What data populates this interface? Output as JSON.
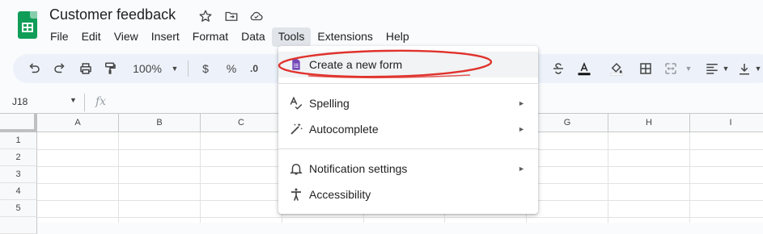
{
  "doc": {
    "title": "Customer feedback"
  },
  "menubar": [
    "File",
    "Edit",
    "View",
    "Insert",
    "Format",
    "Data",
    "Tools",
    "Extensions",
    "Help"
  ],
  "toolbar": {
    "zoom": "100%",
    "currency": "$",
    "percent": "%",
    "decimal": ".0"
  },
  "formula_bar": {
    "cell_ref": "J18",
    "fx": "fx"
  },
  "grid": {
    "columns": [
      "A",
      "B",
      "C",
      "G",
      "H",
      "I"
    ],
    "rows": [
      "1",
      "2",
      "3",
      "4",
      "5"
    ]
  },
  "tools_menu": {
    "items": [
      {
        "label": "Create a new form",
        "icon": "forms-icon",
        "submenu": false
      },
      {
        "label": "Spelling",
        "icon": "spellcheck-icon",
        "submenu": true
      },
      {
        "label": "Autocomplete",
        "icon": "magic-wand-icon",
        "submenu": true
      },
      {
        "label": "Notification settings",
        "icon": "bell-icon",
        "submenu": true
      },
      {
        "label": "Accessibility",
        "icon": "accessibility-icon",
        "submenu": false
      }
    ]
  },
  "colors": {
    "annotation": "#e0322c",
    "forms_purple": "#7248b9",
    "sheets_green": "#0f9d58"
  }
}
